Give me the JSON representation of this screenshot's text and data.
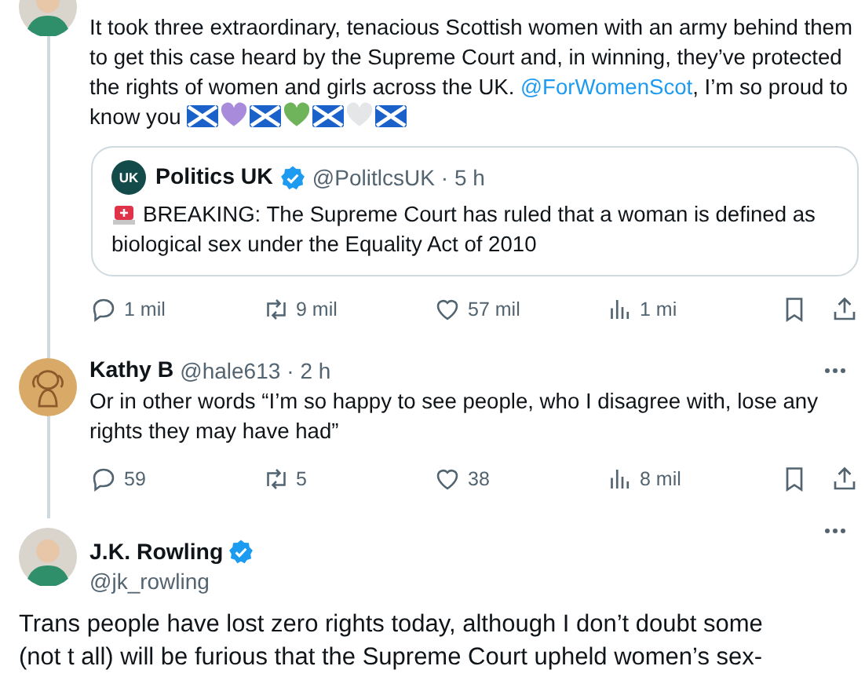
{
  "thread": [
    {
      "kind": "post",
      "text": "It took three extraordinary, tenacious Scottish women with an army behind them to get this case heard by the Supreme Court and, in winning, they’ve protected the rights of women and girls across the UK. ",
      "mention": "@ForWomenScot",
      "text_after": ", I’m so proud to know you",
      "emoji": [
        {
          "kind": "flag"
        },
        {
          "kind": "heart",
          "color": "#a98bdc"
        },
        {
          "kind": "flag"
        },
        {
          "kind": "heart",
          "color": "#6fb35a"
        },
        {
          "kind": "flag"
        },
        {
          "kind": "heart",
          "color": "#e4e6e8"
        },
        {
          "kind": "flag"
        }
      ],
      "quoted": {
        "logo_text": "UK",
        "name": "Politics UK",
        "verified": true,
        "handle": "@PolitlcsUK",
        "time": "· 5 h",
        "text": "BREAKING: The Supreme Court has ruled that a woman is defined as biological sex under the Equality Act of 2010"
      },
      "actions": [
        {
          "kind": "reply",
          "count": "1 mil"
        },
        {
          "kind": "repost",
          "count": "9 mil"
        },
        {
          "kind": "like",
          "count": "57 mil"
        },
        {
          "kind": "views",
          "count": "1 mi"
        },
        {
          "kind": "bookmark"
        },
        {
          "kind": "share"
        }
      ]
    },
    {
      "kind": "reply",
      "name": "Kathy B",
      "verified": false,
      "handle": "@hale613",
      "time": "· 2 h",
      "text": "Or in other words “I’m so happy to see people, who I disagree with, lose any rights they may have had”",
      "actions": [
        {
          "kind": "reply",
          "count": "59"
        },
        {
          "kind": "repost",
          "count": "5"
        },
        {
          "kind": "like",
          "count": "38"
        },
        {
          "kind": "views",
          "count": "8 mil"
        },
        {
          "kind": "bookmark"
        },
        {
          "kind": "share"
        }
      ]
    },
    {
      "kind": "main",
      "name": "J.K. Rowling",
      "verified": true,
      "handle": "@jk_rowling",
      "text": "Trans people have lost zero rights today, although I don’t doubt some (not t all) will be furious that the Supreme Court upheld women’s sex-"
    }
  ]
}
